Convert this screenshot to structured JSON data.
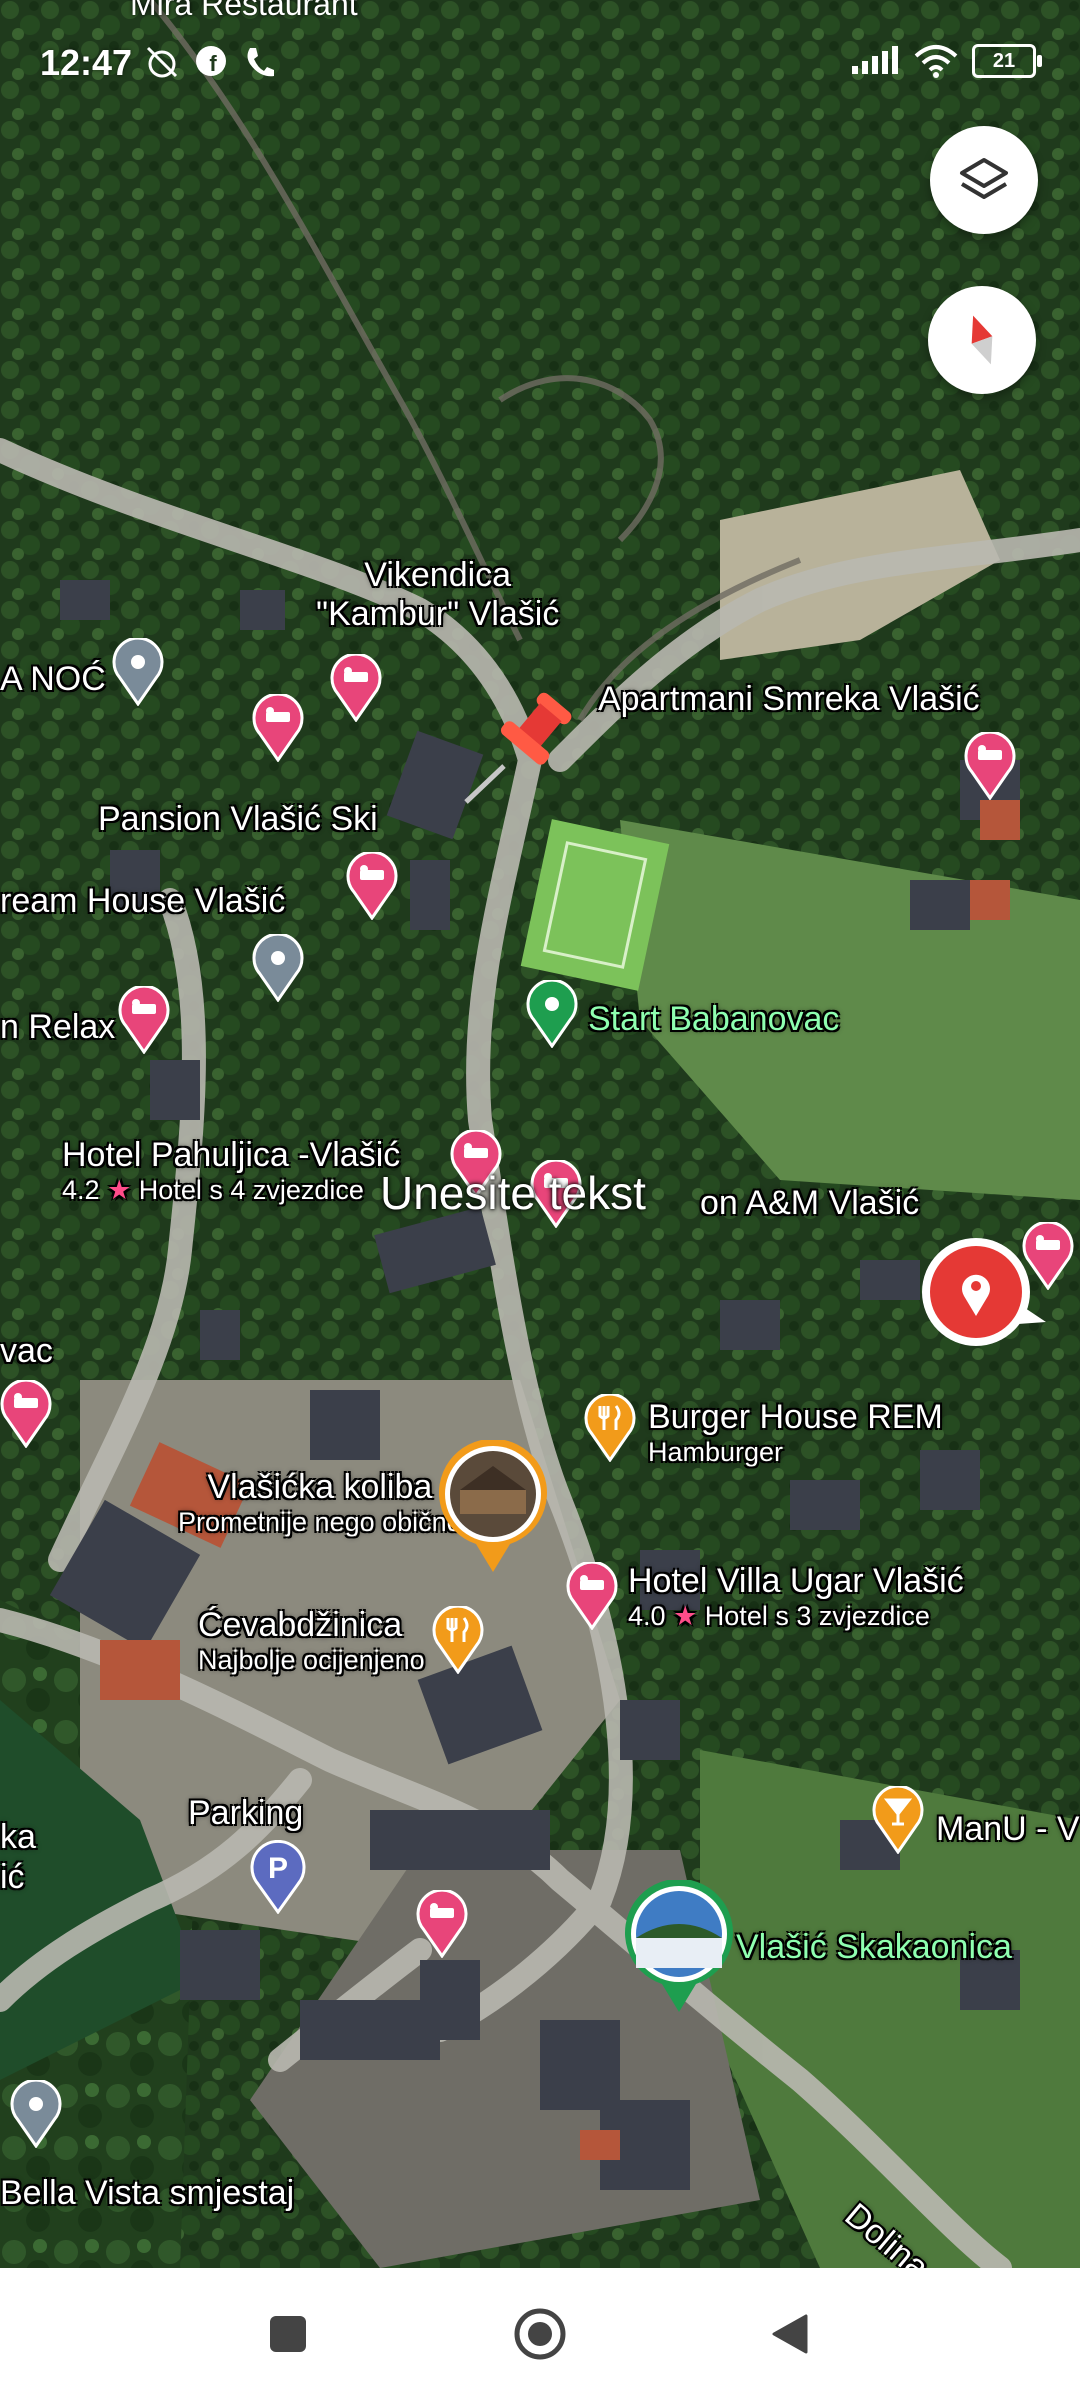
{
  "status_bar": {
    "time": "12:47",
    "battery": "21",
    "top_clip_text": "Mira   Restaurant"
  },
  "map_type": "satellite",
  "overlay_text": "Unesite tekst",
  "labels": {
    "vikendica": "Vikendica\n\"Kambur\" Vlašić",
    "a_noc": "A NOĆ",
    "apartmani": "Apartmani Smreka Vlašić",
    "pansion_ski": "Pansion Vlašić Ski",
    "dream_house": "ream House Vlašić",
    "relax": "n Relax",
    "start": "Start Babanovac",
    "pahuljica_name": "Hotel Pahuljica -Vlašić",
    "pahuljica_rating": "4.2",
    "pahuljica_type": "Hotel s 4 zvjezdice",
    "am_vlasic": "on A&M Vlašić",
    "vac": "vac",
    "burger_name": "Burger House REM",
    "burger_sub": "Hamburger",
    "koliba_name": "Vlašićka koliba",
    "koliba_sub": "Prometnije nego obično",
    "ugar_name": "Hotel Villa Ugar Vlašić",
    "ugar_rating": "4.0",
    "ugar_type": "Hotel s 3 zvjezdice",
    "cevab_name": "Ćevabdžinica",
    "cevab_sub": "Najbolje ocijenjeno",
    "parking": "Parking",
    "manu": "ManU - V",
    "skakaonica": "Vlašić Skakaonica",
    "ka": "ka",
    "ic": "ić",
    "bella": "Bella Vista smjestaj",
    "dolina": "Dolina p"
  },
  "colors": {
    "hotel_pin": "#e8457a",
    "food_pin": "#f29b1a",
    "green_pin": "#1e9e4f",
    "grey_pin": "#7a8b99",
    "parking_pin": "#5c6bc0",
    "red_dropped_pin": "#e53935"
  },
  "icons": {
    "layers": "layers-icon",
    "compass": "compass-icon",
    "location": "location-marker-icon",
    "nav_recent": "square-icon",
    "nav_home": "circle-icon",
    "nav_back": "triangle-back-icon"
  }
}
